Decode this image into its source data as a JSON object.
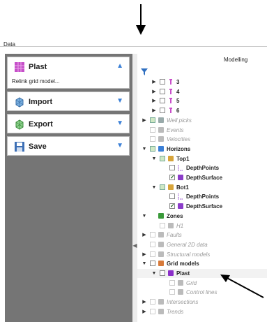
{
  "panel": {
    "title": "Data"
  },
  "actions": [
    {
      "key": "plast",
      "label": "Plast",
      "sub": "Relink grid model...",
      "chevron": "▲"
    },
    {
      "key": "import",
      "label": "Import",
      "chevron": "▼"
    },
    {
      "key": "export",
      "label": "Export",
      "chevron": "▼"
    },
    {
      "key": "save",
      "label": "Save",
      "chevron": "▼"
    }
  ],
  "right": {
    "header": "Modelling"
  },
  "tree": [
    {
      "name": "tree-well-3",
      "toggle": "▶",
      "checkbox": "empty",
      "icon": "well-icon",
      "label": "3",
      "style": "bold",
      "indent": 1
    },
    {
      "name": "tree-well-4",
      "toggle": "▶",
      "checkbox": "empty",
      "icon": "well-icon",
      "label": "4",
      "style": "bold",
      "indent": 1
    },
    {
      "name": "tree-well-5",
      "toggle": "▶",
      "checkbox": "empty",
      "icon": "well-icon",
      "label": "5",
      "style": "bold",
      "indent": 1
    },
    {
      "name": "tree-well-6",
      "toggle": "▶",
      "checkbox": "empty",
      "icon": "well-icon",
      "label": "6",
      "style": "bold",
      "indent": 1
    },
    {
      "name": "tree-well-picks",
      "toggle": "▶",
      "checkbox": "green",
      "icon": "well-picks-icon",
      "label": "Well picks",
      "style": "italic",
      "indent": 0
    },
    {
      "name": "tree-events",
      "toggle": "",
      "checkbox": "dim",
      "icon": "events-icon",
      "label": "Events",
      "style": "italic",
      "indent": 0
    },
    {
      "name": "tree-velocities",
      "toggle": "",
      "checkbox": "dim",
      "icon": "velocities-icon",
      "label": "Velocities",
      "style": "italic",
      "indent": 0
    },
    {
      "name": "tree-horizons",
      "toggle": "▼",
      "checkbox": "green",
      "icon": "horizons-icon",
      "label": "Horizons",
      "style": "bold",
      "indent": 0
    },
    {
      "name": "tree-top1",
      "toggle": "▼",
      "checkbox": "green",
      "icon": "horizon-folder-icon",
      "label": "Top1",
      "style": "bold",
      "indent": 1
    },
    {
      "name": "tree-top1-depthpoints",
      "toggle": "",
      "checkbox": "empty",
      "icon": "points-icon",
      "label": "DepthPoints",
      "style": "bold",
      "indent": 2
    },
    {
      "name": "tree-top1-depthsurface",
      "toggle": "",
      "checkbox": "checked",
      "icon": "surface-icon",
      "label": "DepthSurface",
      "style": "bold",
      "indent": 2
    },
    {
      "name": "tree-bot1",
      "toggle": "▼",
      "checkbox": "green",
      "icon": "horizon-folder-icon",
      "label": "Bot1",
      "style": "bold",
      "indent": 1
    },
    {
      "name": "tree-bot1-depthpoints",
      "toggle": "",
      "checkbox": "empty",
      "icon": "points-icon",
      "label": "DepthPoints",
      "style": "bold",
      "indent": 2
    },
    {
      "name": "tree-bot1-depthsurface",
      "toggle": "",
      "checkbox": "checked",
      "icon": "surface-icon",
      "label": "DepthSurface",
      "style": "bold",
      "indent": 2
    },
    {
      "name": "tree-zones",
      "toggle": "▼",
      "checkbox": "none",
      "icon": "zones-icon",
      "label": "Zones",
      "style": "bold",
      "indent": 0
    },
    {
      "name": "tree-h1",
      "toggle": "",
      "checkbox": "dim",
      "icon": "zone-icon",
      "label": "H1",
      "style": "italic",
      "indent": 1
    },
    {
      "name": "tree-faults",
      "toggle": "▶",
      "checkbox": "dim",
      "icon": "faults-icon",
      "label": "Faults",
      "style": "italic",
      "indent": 0
    },
    {
      "name": "tree-general-2d-data",
      "toggle": "",
      "checkbox": "dim",
      "icon": "2d-data-icon",
      "label": "General 2D data",
      "style": "italic",
      "indent": 0
    },
    {
      "name": "tree-structural-models",
      "toggle": "▶",
      "checkbox": "dim",
      "icon": "structural-icon",
      "label": "Structural models",
      "style": "italic",
      "indent": 0
    },
    {
      "name": "tree-grid-models",
      "toggle": "▼",
      "checkbox": "empty",
      "icon": "grid-models-icon",
      "label": "Grid models",
      "style": "bold",
      "indent": 0
    },
    {
      "name": "tree-plast",
      "toggle": "▼",
      "checkbox": "empty",
      "icon": "grid-cube-icon",
      "label": "Plast",
      "style": "bold",
      "indent": 1,
      "selected": true
    },
    {
      "name": "tree-grid",
      "toggle": "",
      "checkbox": "dim",
      "icon": "grid-icon",
      "label": "Grid",
      "style": "italic",
      "indent": 2
    },
    {
      "name": "tree-control-lines",
      "toggle": "",
      "checkbox": "dim",
      "icon": "control-lines-icon",
      "label": "Control lines",
      "style": "italic",
      "indent": 2
    },
    {
      "name": "tree-intersections",
      "toggle": "▶",
      "checkbox": "dim",
      "icon": "intersections-icon",
      "label": "Intersections",
      "style": "italic",
      "indent": 0
    },
    {
      "name": "tree-trends",
      "toggle": "▶",
      "checkbox": "dim",
      "icon": "trends-icon",
      "label": "Trends",
      "style": "italic",
      "indent": 0
    }
  ]
}
